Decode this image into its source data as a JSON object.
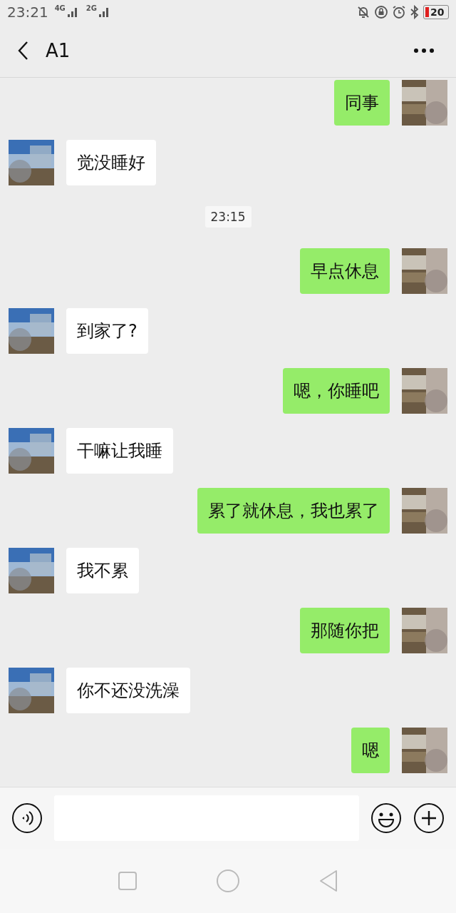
{
  "status_bar": {
    "time": "23:21",
    "network_1": "4G",
    "network_2": "2G",
    "battery": "20"
  },
  "header": {
    "title": "A1"
  },
  "messages": [
    {
      "kind": "sent",
      "text": "同事"
    },
    {
      "kind": "received",
      "text": "觉没睡好"
    },
    {
      "kind": "time",
      "text": "23:15"
    },
    {
      "kind": "sent",
      "text": "早点休息"
    },
    {
      "kind": "received",
      "text": "到家了?"
    },
    {
      "kind": "sent",
      "text": "嗯，你睡吧"
    },
    {
      "kind": "received",
      "text": "干嘛让我睡"
    },
    {
      "kind": "sent",
      "text": "累了就休息，我也累了"
    },
    {
      "kind": "received",
      "text": "我不累"
    },
    {
      "kind": "sent",
      "text": "那随你把"
    },
    {
      "kind": "received",
      "text": "你不还没洗澡"
    },
    {
      "kind": "sent",
      "text": "嗯"
    }
  ]
}
